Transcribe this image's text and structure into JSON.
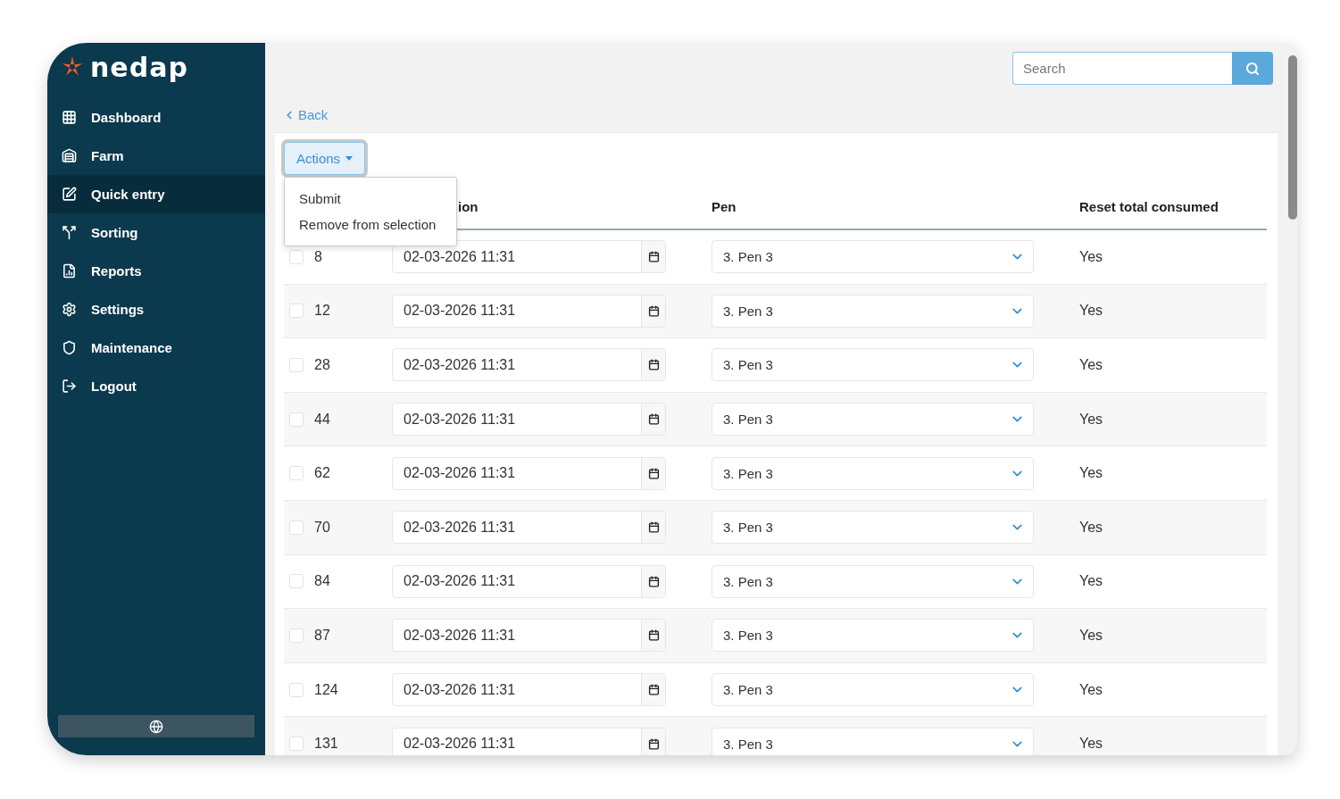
{
  "sidebar": {
    "logo": "nedap",
    "items": [
      {
        "label": "Dashboard",
        "selected": false
      },
      {
        "label": "Farm",
        "selected": false
      },
      {
        "label": "Quick entry",
        "selected": true
      },
      {
        "label": "Sorting",
        "selected": false
      },
      {
        "label": "Reports",
        "selected": false
      },
      {
        "label": "Settings",
        "selected": false
      },
      {
        "label": "Maintenance",
        "selected": false
      },
      {
        "label": "Logout",
        "selected": false
      }
    ]
  },
  "search": {
    "placeholder": "Search"
  },
  "back_link": "Back",
  "actions": {
    "label": "Actions",
    "expanded": true,
    "items": [
      "Submit",
      "Remove from selection"
    ]
  },
  "table": {
    "columns": [
      "ion",
      "Pen",
      "Reset total consumed"
    ],
    "rows": [
      {
        "number": "8",
        "date": "02-03-2026 11:31",
        "pen": "3. Pen 3",
        "reset": "Yes",
        "checked": false
      },
      {
        "number": "12",
        "date": "02-03-2026 11:31",
        "pen": "3. Pen 3",
        "reset": "Yes",
        "checked": false
      },
      {
        "number": "28",
        "date": "02-03-2026 11:31",
        "pen": "3. Pen 3",
        "reset": "Yes",
        "checked": false
      },
      {
        "number": "44",
        "date": "02-03-2026 11:31",
        "pen": "3. Pen 3",
        "reset": "Yes",
        "checked": false
      },
      {
        "number": "62",
        "date": "02-03-2026 11:31",
        "pen": "3. Pen 3",
        "reset": "Yes",
        "checked": false
      },
      {
        "number": "70",
        "date": "02-03-2026 11:31",
        "pen": "3. Pen 3",
        "reset": "Yes",
        "checked": false
      },
      {
        "number": "84",
        "date": "02-03-2026 11:31",
        "pen": "3. Pen 3",
        "reset": "Yes",
        "checked": false
      },
      {
        "number": "87",
        "date": "02-03-2026 11:31",
        "pen": "3. Pen 3",
        "reset": "Yes",
        "checked": false
      },
      {
        "number": "124",
        "date": "02-03-2026 11:31",
        "pen": "3. Pen 3",
        "reset": "Yes",
        "checked": false
      },
      {
        "number": "131",
        "date": "02-03-2026 11:31",
        "pen": "3. Pen 3",
        "reset": "Yes",
        "checked": false
      }
    ]
  }
}
